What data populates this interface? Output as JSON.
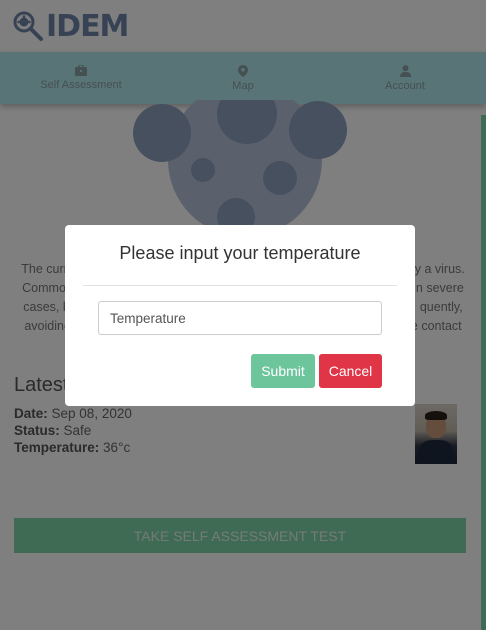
{
  "app": {
    "name": "IDEM"
  },
  "nav": {
    "items": [
      {
        "label": "Self Assessment",
        "icon": "briefcase-icon"
      },
      {
        "label": "Map",
        "icon": "map-pin-icon"
      },
      {
        "label": "Account",
        "icon": "user-icon"
      }
    ]
  },
  "description": {
    "lines": [
      "The current ██████████████████████████████████████████ by a virus.",
      "Common ███████████████████████████████████████████████ n severe",
      "cases, b ████████████████████████████████████████████ quently,",
      "avoiding ███████████████████████████████████████████ e contact"
    ],
    "visible_fragments": {
      "line1_start": "The curre",
      "line1_end": "y a virus.",
      "line2_start": "Commo",
      "line2_end": "n severe",
      "line3_start": "cases, b",
      "line3_end": "quently,",
      "line4_start": "avoiding",
      "line4_end": "e contact"
    }
  },
  "latest": {
    "heading": "Latest",
    "date_label": "Date:",
    "date_value": "Sep 08, 2020",
    "status_label": "Status:",
    "status_value": "Safe",
    "temperature_label": "Temperature:",
    "temperature_value": "36°c"
  },
  "take_test_label": "TAKE SELF ASSESSMENT TEST",
  "modal": {
    "title": "Please input your temperature",
    "input_placeholder": "Temperature",
    "input_value": "",
    "submit_label": "Submit",
    "cancel_label": "Cancel"
  },
  "colors": {
    "nav_bg": "#b3e8ee",
    "accent_green": "#7fd4a8",
    "submit_green": "#6cc59b",
    "cancel_red": "#e03546",
    "logo_blue": "#6f86a8"
  }
}
